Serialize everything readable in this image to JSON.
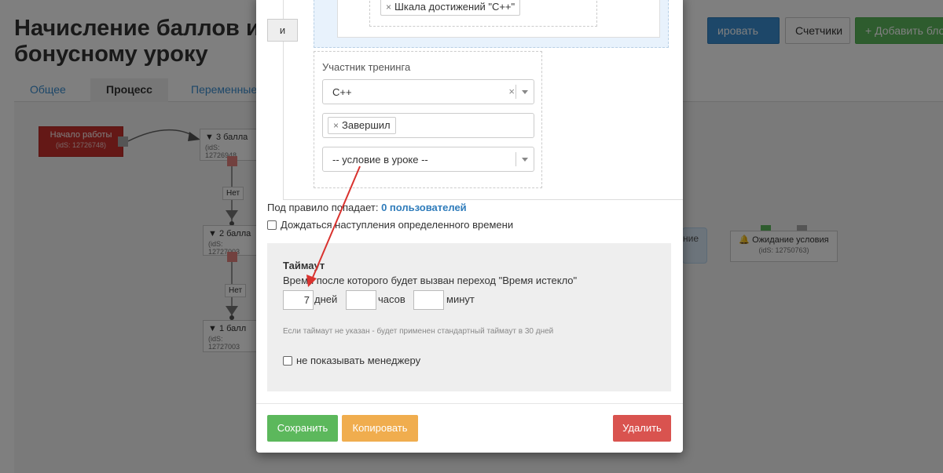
{
  "page": {
    "title": "Начисление баллов и бонусному уроку",
    "buttons": {
      "copy_partial": "ировать",
      "counters": "Счетчики",
      "add_block": "+ Добавить бло"
    },
    "tabs": [
      "Общее",
      "Процесс",
      "Переменные"
    ]
  },
  "flow": {
    "start_node": {
      "label": "Начало работы",
      "ids": "(idS: 12726748)"
    },
    "node_3": {
      "label": "3 балла",
      "ids": "(idS: 12726948"
    },
    "node_2": {
      "label": "2 балла",
      "ids": "(idS: 12727003"
    },
    "node_1": {
      "label": "1 балл",
      "ids": "(idS: 12727003"
    },
    "no_label": "Нет",
    "wait_node": {
      "label": "Ожидание условия",
      "ids": "(idS: 12750763)"
    },
    "partial_right": "ние"
  },
  "modal": {
    "and_button": "и",
    "achievement_tag": "Шкала достижений \"C++\"",
    "participant": {
      "label": "Участник тренинга",
      "training_value": "C++",
      "status_tag": "Завершил",
      "lesson_condition": "-- условие в уроке --"
    },
    "match_prefix": "Под правило попадает:",
    "match_link": "0 пользователей",
    "wait_checkbox": "Дождаться наступления определенного времени",
    "timeout": {
      "title": "Таймаут",
      "description": "Время после которого будет вызван переход \"Время истекло\"",
      "days_value": "7",
      "days_unit": "дней",
      "hours_value": "",
      "hours_unit": "часов",
      "minutes_value": "",
      "minutes_unit": "минут",
      "hint": "Если таймаут не указан - будет применен стандартный таймаут в 30 дней",
      "hide_manager": "не показывать менеджеру"
    },
    "footer": {
      "save": "Сохранить",
      "copy": "Копировать",
      "delete": "Удалить"
    }
  },
  "colors": {
    "save": "#5cb85c",
    "copy": "#f0ad4e",
    "delete": "#d9534f",
    "link": "#2f7cbb",
    "annotation_arrow": "#d9322e"
  }
}
